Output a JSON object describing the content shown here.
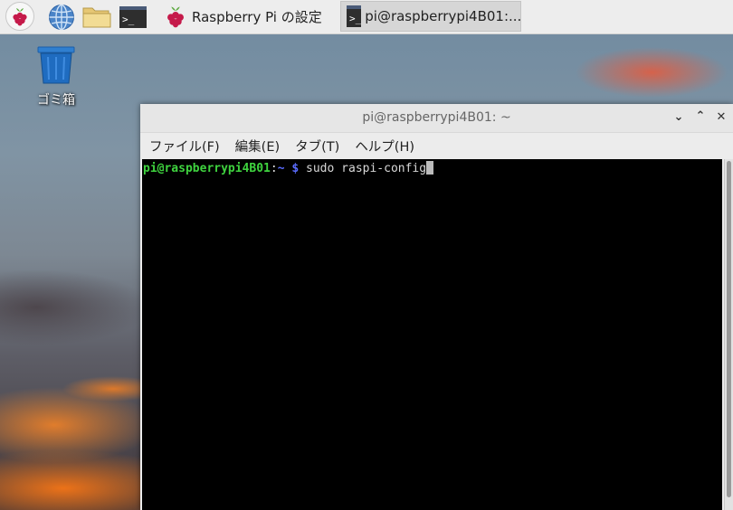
{
  "taskbar": {
    "tasks": [
      {
        "label": "Raspberry Pi の設定",
        "icon": "raspberry-icon"
      },
      {
        "label": "pi@raspberrypi4B01:...",
        "icon": "terminal-icon"
      }
    ]
  },
  "desktop": {
    "trash_label": "ゴミ箱"
  },
  "window": {
    "title": "pi@raspberrypi4B01: ~",
    "menu": [
      "ファイル(F)",
      "編集(E)",
      "タブ(T)",
      "ヘルプ(H)"
    ]
  },
  "terminal": {
    "user_host": "pi@raspberrypi4B01",
    "colon": ":",
    "path": "~",
    "dollar": "$",
    "command": "sudo raspi-config"
  }
}
